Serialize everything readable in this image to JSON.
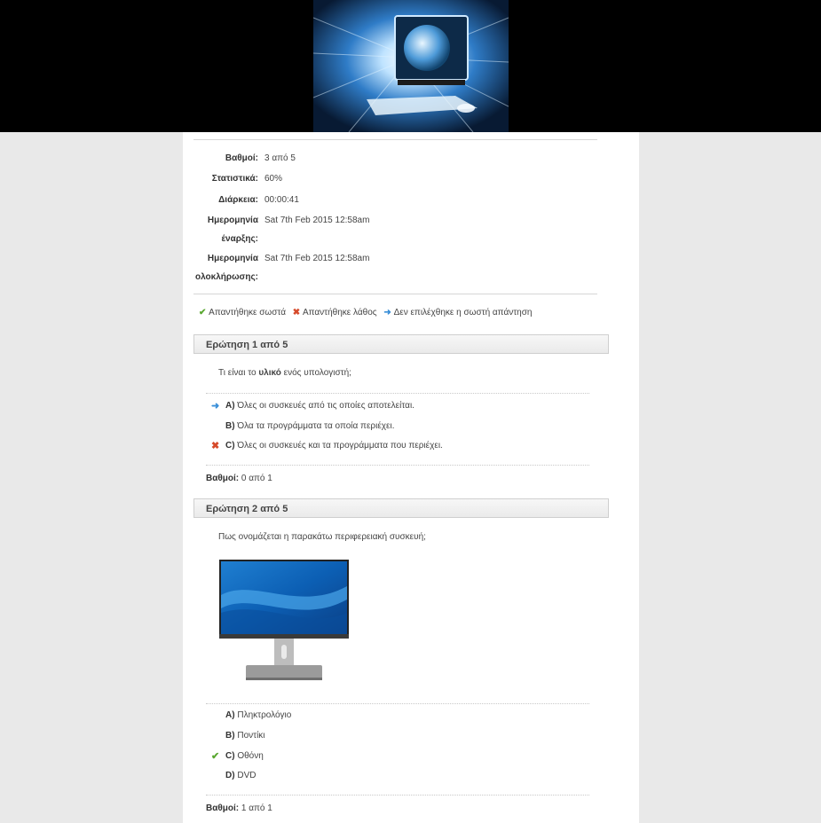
{
  "stats": {
    "score_label": "Βαθμοί:",
    "score_value": "3 από 5",
    "stats_label": "Στατιστικά:",
    "stats_value": "60%",
    "duration_label": "Διάρκεια:",
    "duration_value": "00:00:41",
    "start_label_1": "Ημερομηνία",
    "start_label_2": "έναρξης:",
    "start_value": "Sat 7th Feb 2015 12:58am",
    "end_label_1": "Ημερομηνία",
    "end_label_2": "ολοκλήρωσης:",
    "end_value": "Sat 7th Feb 2015 12:58am"
  },
  "legend": {
    "correct": "Απαντήθηκε σωστά",
    "wrong": "Απαντήθηκε λάθος",
    "missed": "Δεν επιλέχθηκε η σωστή απάντηση"
  },
  "q1": {
    "header": "Ερώτηση 1 από 5",
    "text_pre": "Τι είναι το ",
    "text_bold": "υλικό",
    "text_post": " ενός υπολογιστή;",
    "answers": [
      {
        "letter": "A)",
        "text": "Όλες οι συσκευές από τις οποίες αποτελείται."
      },
      {
        "letter": "B)",
        "text": "Όλα τα προγράμματα τα οποία περιέχει."
      },
      {
        "letter": "C)",
        "text": "Όλες οι συσκευές και τα προγράμματα που περιέχει."
      }
    ],
    "score_label": "Βαθμοί:",
    "score_value": "0 από 1"
  },
  "q2": {
    "header": "Ερώτηση 2 από 5",
    "text": "Πως ονομάζεται η παρακάτω περιφερειακή συσκευή;",
    "answers": [
      {
        "letter": "A)",
        "text": "Πληκτρολόγιο"
      },
      {
        "letter": "B)",
        "text": "Ποντίκι"
      },
      {
        "letter": "C)",
        "text": "Οθόνη"
      },
      {
        "letter": "D)",
        "text": "DVD"
      }
    ],
    "score_label": "Βαθμοί:",
    "score_value": "1 από 1"
  },
  "icons": {
    "correct": "check-icon",
    "wrong": "cross-icon",
    "missed": "arrow-right-icon"
  },
  "colors": {
    "correct": "#5aa831",
    "wrong": "#d64a2b",
    "missed": "#3a8fd8"
  }
}
